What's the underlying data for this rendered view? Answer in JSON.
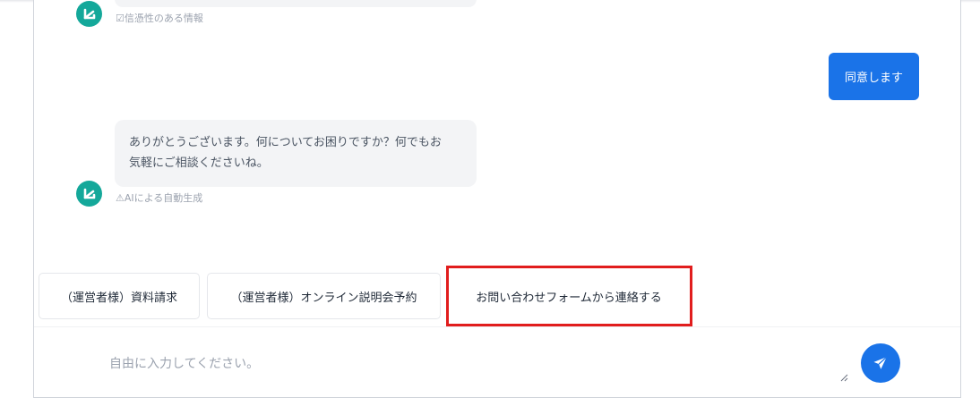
{
  "chat": {
    "prev_bot_meta": "☑信憑性のある情報",
    "user_message": "同意します",
    "bot_message_line1": "ありがとうございます。何についてお困りですか？何でもお",
    "bot_message_line2": "気軽にご相談くださいね。",
    "bot_meta": "⚠AIによる自動生成"
  },
  "quick_replies": [
    {
      "label": "（運営者様）資料請求"
    },
    {
      "label": "（運営者様）オンライン説明会予約"
    },
    {
      "label": "お問い合わせフォームから連絡する"
    }
  ],
  "composer": {
    "placeholder": "自由に入力してください。"
  },
  "colors": {
    "accent": "#1a73e8",
    "avatar": "#14a89a",
    "highlight": "#e11d1d",
    "bot_bubble": "#f3f4f6"
  },
  "icons": {
    "avatar": "bot-logo-icon",
    "send": "paper-plane-icon"
  }
}
